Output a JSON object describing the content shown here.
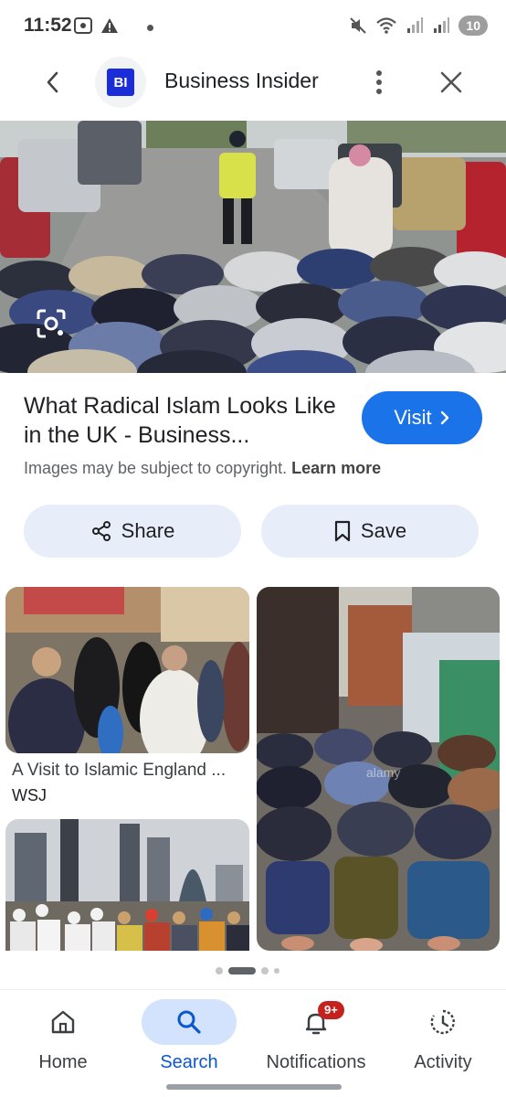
{
  "status_bar": {
    "time": "11:52",
    "battery": "10"
  },
  "header": {
    "logo_text": "BI",
    "site_name": "Business Insider",
    "back_icon": "back-arrow-icon",
    "more_icon": "more-vert-icon",
    "close_icon": "close-icon"
  },
  "result": {
    "title": "What Radical Islam Looks Like in the UK - Business...",
    "visit_label": "Visit",
    "copyright_text": "Images may be subject to copyright.",
    "learn_more": "Learn more"
  },
  "actions": {
    "share_label": "Share",
    "save_label": "Save"
  },
  "related": [
    {
      "title": "A Visit to Islamic England ...",
      "source": "WSJ"
    },
    {
      "title": "",
      "source": ""
    },
    {
      "title": "",
      "source": ""
    }
  ],
  "image_watermark": "alamy",
  "nav": {
    "items": [
      {
        "label": "Home",
        "icon": "home-icon"
      },
      {
        "label": "Search",
        "icon": "search-icon",
        "active": true
      },
      {
        "label": "Notifications",
        "icon": "bell-icon",
        "badge": "9+"
      },
      {
        "label": "Activity",
        "icon": "history-icon"
      }
    ]
  },
  "colors": {
    "accent": "#1a73e8",
    "active_tab_bg": "#d3e3fd",
    "badge": "#c5221f",
    "action_bg": "#e8eef9"
  }
}
